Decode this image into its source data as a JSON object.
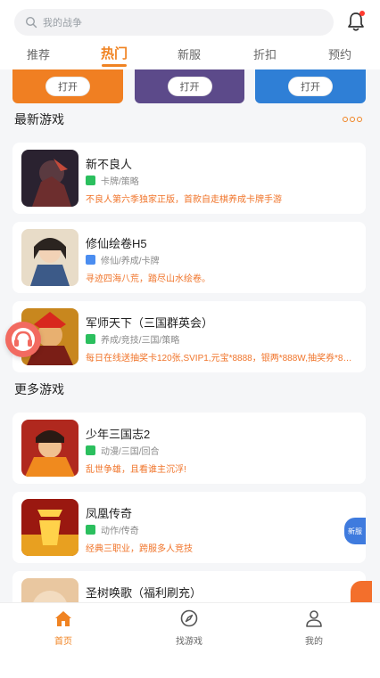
{
  "search": {
    "placeholder": "我的战争"
  },
  "tabs": [
    {
      "label": "推荐",
      "active": false
    },
    {
      "label": "热门",
      "active": true
    },
    {
      "label": "新服",
      "active": false
    },
    {
      "label": "折扣",
      "active": false
    },
    {
      "label": "预约",
      "active": false
    }
  ],
  "banners": [
    {
      "button": "打开",
      "color": "#f07f22"
    },
    {
      "button": "打开",
      "color": "#5c4a8a"
    },
    {
      "button": "打开",
      "color": "#2f7fd6"
    }
  ],
  "sections": {
    "latest": "最新游戏",
    "more": "更多游戏"
  },
  "latest_games": [
    {
      "name": "新不良人",
      "tags": "卡牌/策略",
      "tag_icon_color": "#2bbf5e",
      "desc": "不良人第六季独家正版，首款自走棋养成卡牌手游"
    },
    {
      "name": "修仙绘卷H5",
      "tags": "修仙/养成/卡牌",
      "tag_icon_color": "#4a8df0",
      "desc": "寻迹四海八荒，踏尽山水绘卷。"
    },
    {
      "name": "军师天下（三国群英会）",
      "tags": "养成/竞技/三国/策略",
      "tag_icon_color": "#2bbf5e",
      "desc": "每日在线送抽奖卡120张,SVIP1,元宝*8888，银两*888W,抽奖券*88,福..."
    }
  ],
  "more_games": [
    {
      "name": "少年三国志2",
      "tags": "动漫/三国/回合",
      "tag_icon_color": "#2bbf5e",
      "desc": "乱世争雄，且看谁主沉浮!"
    },
    {
      "name": "凤凰传奇",
      "tags": "动作/传奇",
      "tag_icon_color": "#2bbf5e",
      "desc": "经典三职业，跨服多人竞技"
    },
    {
      "name": "圣树唤歌（福利刷充）",
      "tags": "",
      "tag_icon_color": "#2bbf5e",
      "desc": ""
    }
  ],
  "side_badge": "新服",
  "bottom_nav": [
    {
      "label": "首页",
      "active": true
    },
    {
      "label": "找游戏",
      "active": false
    },
    {
      "label": "我的",
      "active": false
    }
  ],
  "colors": {
    "accent": "#f08322",
    "desc_orange": "#f0742a"
  }
}
